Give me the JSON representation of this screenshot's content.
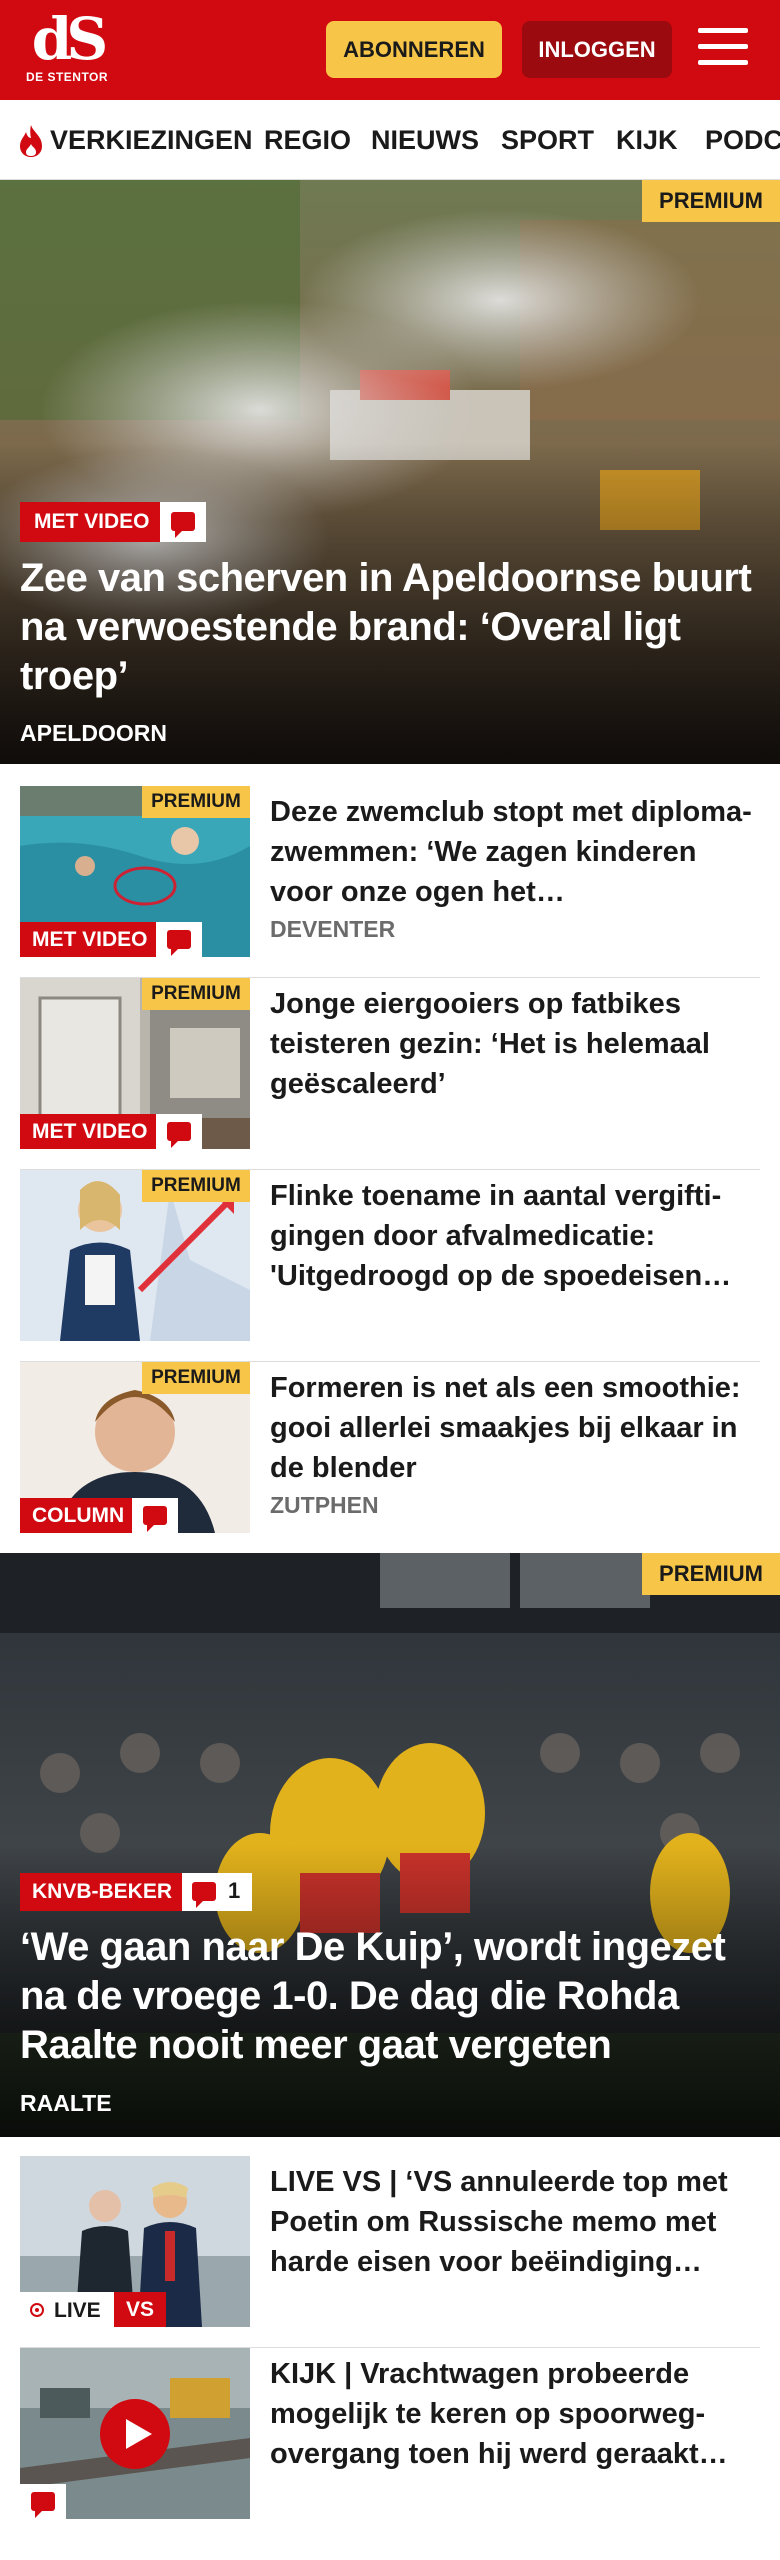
{
  "header": {
    "logo_text": "dS",
    "logo_sub": "DE STENTOR",
    "subscribe_label": "ABONNEREN",
    "login_label": "INLOGGEN",
    "menu_icon": "hamburger-icon",
    "brand_color": "#d10a11",
    "accent_color": "#f7c648"
  },
  "nav": {
    "items": [
      "VERKIEZINGEN",
      "REGIO",
      "NIEUWS",
      "SPORT",
      "KIJK",
      "PODCASTS"
    ],
    "first_item_icon": "flame-icon"
  },
  "lead_story": {
    "badge": "PREMIUM",
    "tag": "MET VIDEO",
    "comment_icon": "comment-icon",
    "title": "Zee van scherven in Apeldoornse buurt na verwoestende brand: ‘Overal ligt troep’",
    "location": "APELDOORN"
  },
  "stories": [
    {
      "title": "Deze zwemclub stopt met diploma-zwemmen: ‘We zagen kinderen voor onze ogen het…",
      "location": "DEVENTER",
      "badge": "PREMIUM",
      "tag": "MET VIDEO"
    },
    {
      "title": "Jonge eiergooiers op fatbikes teisteren gezin: ‘Het is helemaal geëscaleerd’",
      "location": "",
      "badge": "PREMIUM",
      "tag": "MET VIDEO"
    },
    {
      "title": "Flinke toename in aantal vergifti­gingen door afvalmedicatie: 'Uitgedroogd op de spoedeisen…",
      "location": "",
      "badge": "PREMIUM",
      "tag": ""
    },
    {
      "title": "Formeren is net als een smoothie: gooi allerlei smaakjes bij elkaar in de blender",
      "location": "ZUTPHEN",
      "badge": "PREMIUM",
      "tag": "COLUMN"
    }
  ],
  "second_lead": {
    "badge": "PREMIUM",
    "tag": "KNVB-BEKER",
    "comment_count": "1",
    "title": "‘We gaan naar De Kuip’, wordt ingezet na de vroege 1-0. De dag die Rohda Raalte nooit meer gaat vergeten",
    "location": "RAALTE"
  },
  "more_stories": [
    {
      "title": "LIVE VS | ‘VS annuleerde top met Poetin om Russische memo met harde eisen voor beëindiging…",
      "live_label": "LIVE",
      "live_tag": "VS"
    },
    {
      "title": "KIJK | Vrachtwagen probeerde mogelijk te keren op spoorweg­overgang toen hij werd geraakt…",
      "play_icon": "play-icon"
    }
  ]
}
